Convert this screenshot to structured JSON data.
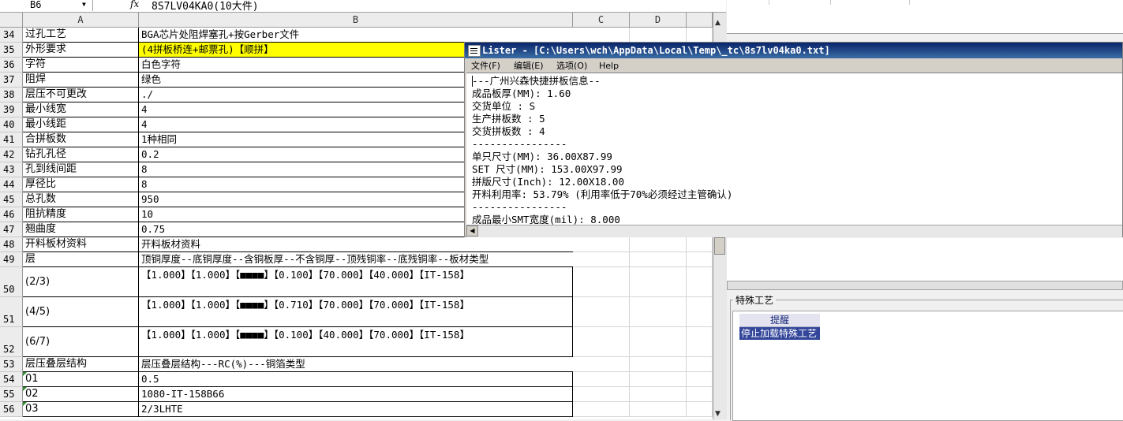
{
  "formula_bar": {
    "cell_ref": "B6",
    "fx": "fx",
    "formula": "8S7LV04KA0(10大件)"
  },
  "columns": [
    "A",
    "B",
    "C",
    "D"
  ],
  "rows": [
    {
      "num": "34",
      "a": "过孔工艺",
      "b": "BGA芯片处阻焊塞孔+按Gerber文件"
    },
    {
      "num": "35",
      "a": "外形要求",
      "b": "(4拼板桥连+邮票孔)【顺拼】"
    },
    {
      "num": "36",
      "a": "字符",
      "b": "白色字符"
    },
    {
      "num": "37",
      "a": "阻焊",
      "b": "绿色"
    },
    {
      "num": "38",
      "a": "层压不可更改",
      "b": "./"
    },
    {
      "num": "39",
      "a": "最小线宽",
      "b": "4"
    },
    {
      "num": "40",
      "a": "最小线距",
      "b": "4"
    },
    {
      "num": "41",
      "a": "合拼板数",
      "b": "1种相同"
    },
    {
      "num": "42",
      "a": "钻孔孔径",
      "b": "0.2"
    },
    {
      "num": "43",
      "a": "孔到线间距",
      "b": "8"
    },
    {
      "num": "44",
      "a": "厚径比",
      "b": "8"
    },
    {
      "num": "45",
      "a": "总孔数",
      "b": "950"
    },
    {
      "num": "46",
      "a": "阻抗精度",
      "b": "10"
    },
    {
      "num": "47",
      "a": "翘曲度",
      "b": "0.75"
    },
    {
      "num": "48",
      "a": "开料板材资料",
      "b": "开料板材资料"
    },
    {
      "num": "49",
      "a": "层",
      "b": "顶铜厚度--底铜厚度--含铜板厚--不含铜厚--顶残铜率--底残铜率--板材类型"
    },
    {
      "num": "50",
      "a": "(2/3)",
      "b": "【1.000】【1.000】【■■■■】【0.100】【70.000】【40.000】【IT-158】"
    },
    {
      "num": "51",
      "a": "(4/5)",
      "b": "【1.000】【1.000】【■■■■】【0.710】【70.000】【70.000】【IT-158】"
    },
    {
      "num": "52",
      "a": "(6/7)",
      "b": "【1.000】【1.000】【■■■■】【0.100】【40.000】【70.000】【IT-158】"
    },
    {
      "num": "53",
      "a": "层压叠层结构",
      "b": "层压叠层结构---RC(%)---铜箔类型"
    },
    {
      "num": "54",
      "a": "01",
      "b": "0.5"
    },
    {
      "num": "55",
      "a": "02",
      "b": "1080-IT-158B66"
    },
    {
      "num": "56",
      "a": "03",
      "b": "2/3LHTE"
    }
  ],
  "lister": {
    "title": "Lister - [C:\\Users\\wch\\AppData\\Local\\Temp\\_tc\\8s7lv04ka0.txt]",
    "menu": [
      "文件(F)",
      "编辑(E)",
      "选项(O)",
      "Help"
    ],
    "lines": [
      "---广州兴森快捷拼板信息--",
      "成品板厚(MM): 1.60",
      "交货单位 : S",
      "生产拼板数 : 5",
      "交货拼板数 : 4",
      "----------------",
      "单只尺寸(MM): 36.00X87.99",
      "SET 尺寸(MM): 153.00X97.99",
      "拼版尺寸(Inch): 12.00X18.00",
      "开料利用率: 53.79% (利用率低于70%必须经过主管确认)",
      "----------------",
      "成品最小SMT宽度(mil): 8.000"
    ]
  },
  "special_process": {
    "title": "特殊工艺",
    "column": "提醒",
    "row": "停止加载特殊工艺"
  }
}
